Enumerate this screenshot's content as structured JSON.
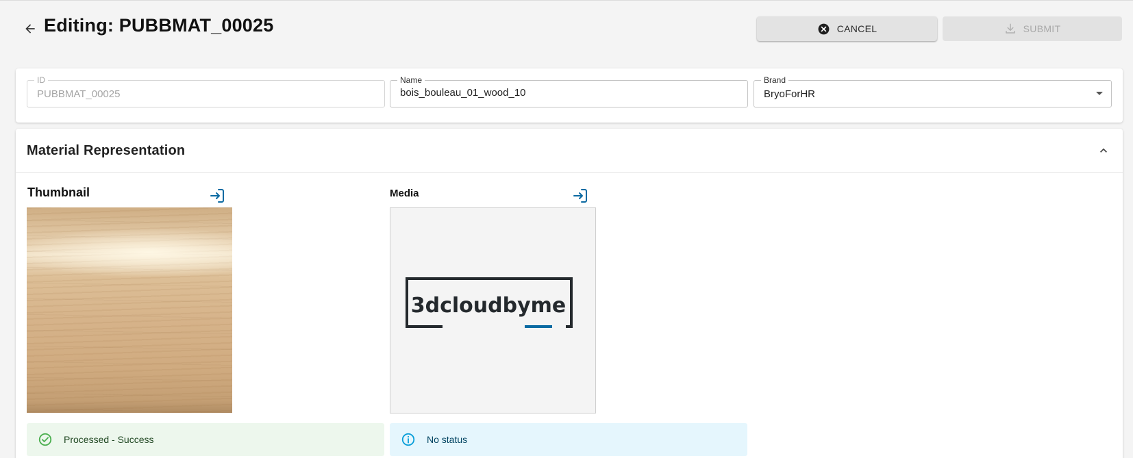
{
  "header": {
    "title": "Editing: PUBBMAT_00025",
    "cancel_label": "CANCEL",
    "submit_label": "SUBMIT"
  },
  "fields": {
    "id": {
      "label": "ID",
      "value": "PUBBMAT_00025"
    },
    "name": {
      "label": "Name",
      "value": "bois_bouleau_01_wood_10"
    },
    "brand": {
      "label": "Brand",
      "value": "BryoForHR"
    }
  },
  "material": {
    "section_title": "Material Representation",
    "thumbnail_label": "Thumbnail",
    "media_label": "Media",
    "media_logo_text": "3dcloudbyme",
    "thumbnail_status": "Processed - Success",
    "media_status": "No status"
  },
  "colors": {
    "accent": "#0b6aa2",
    "success": "#4caf50",
    "info": "#0a9fd9"
  },
  "icons": {
    "back": "arrow-left-icon",
    "cancel": "close-circle-icon",
    "submit": "download-icon",
    "collapse": "chevron-up-icon",
    "import": "login-icon",
    "success": "check-circle-icon",
    "info": "info-circle-icon"
  }
}
